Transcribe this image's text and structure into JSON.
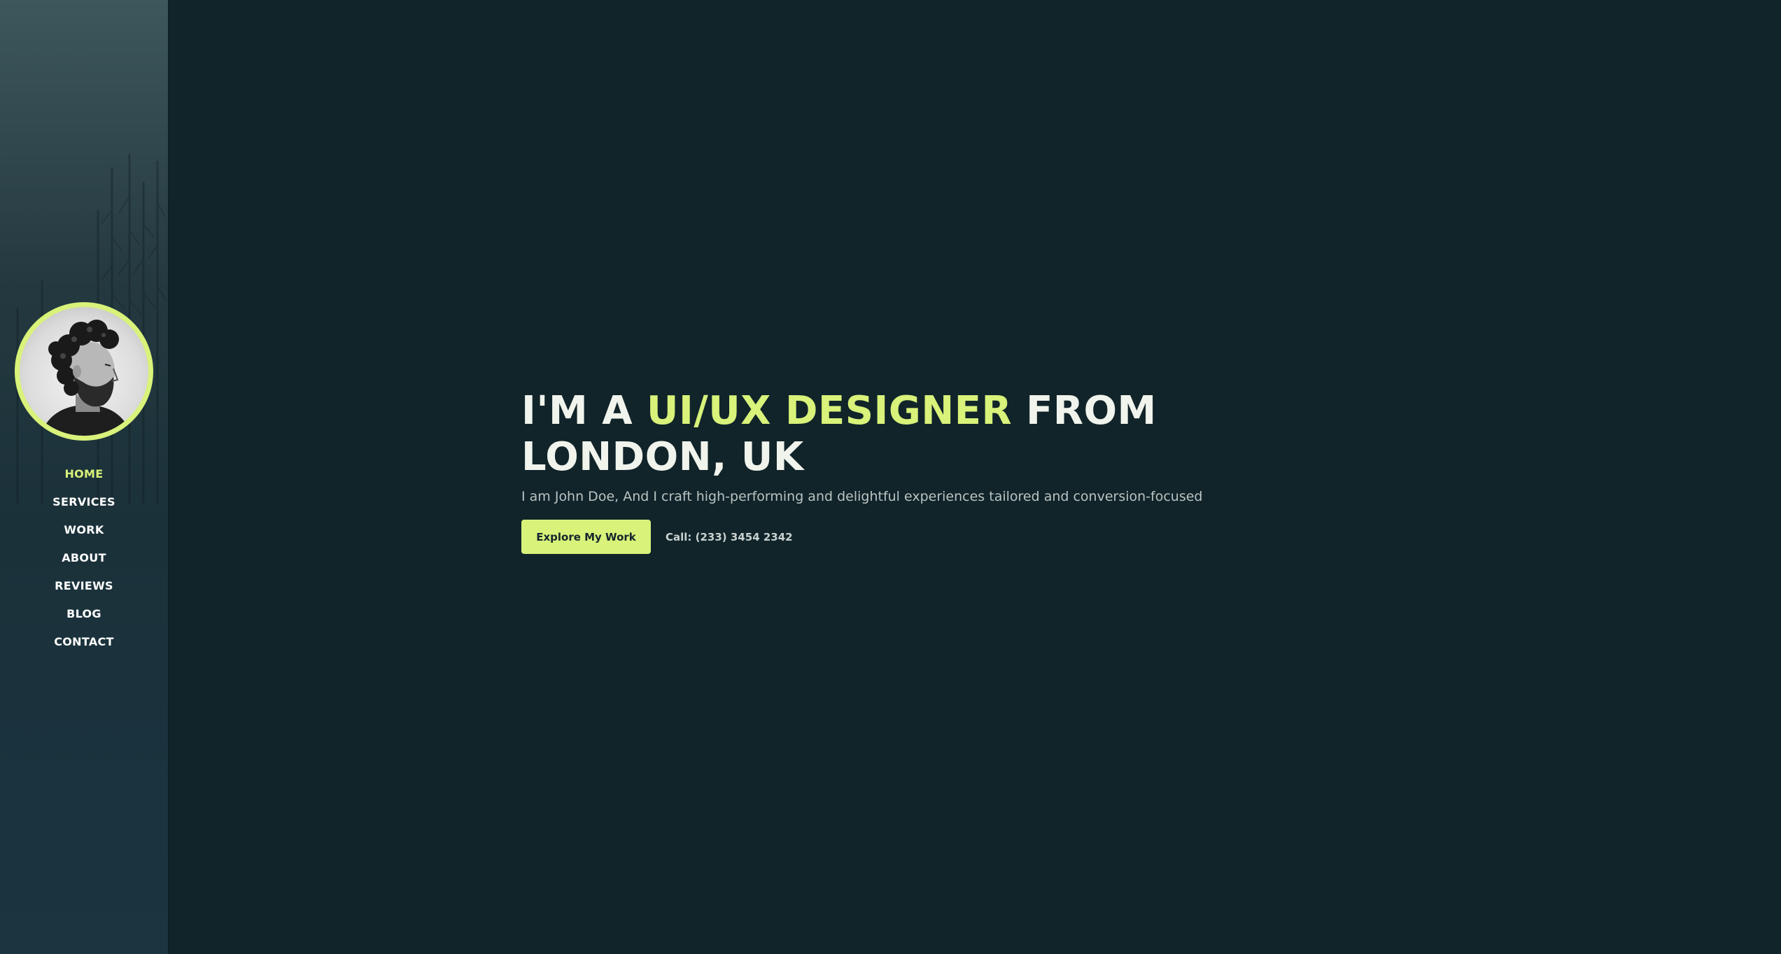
{
  "sidebar": {
    "nav": [
      {
        "label": "HOME",
        "active": true
      },
      {
        "label": "SERVICES",
        "active": false
      },
      {
        "label": "WORK",
        "active": false
      },
      {
        "label": "ABOUT",
        "active": false
      },
      {
        "label": "REVIEWS",
        "active": false
      },
      {
        "label": "BLOG",
        "active": false
      },
      {
        "label": "CONTACT",
        "active": false
      }
    ]
  },
  "hero": {
    "headline_prefix": "I'M A ",
    "headline_accent": "UI/UX DESIGNER",
    "headline_suffix": " FROM LONDON, UK",
    "subtitle": "I am John Doe, And I craft high-performing and delightful experiences tailored and conversion-focused",
    "cta_label": "Explore My Work",
    "call_text": "Call: (233) 3454 2342"
  },
  "colors": {
    "accent": "#d8f27a",
    "background": "#11242a",
    "sidebar": "#1b313a"
  },
  "icons": [
    "profile-avatar"
  ]
}
